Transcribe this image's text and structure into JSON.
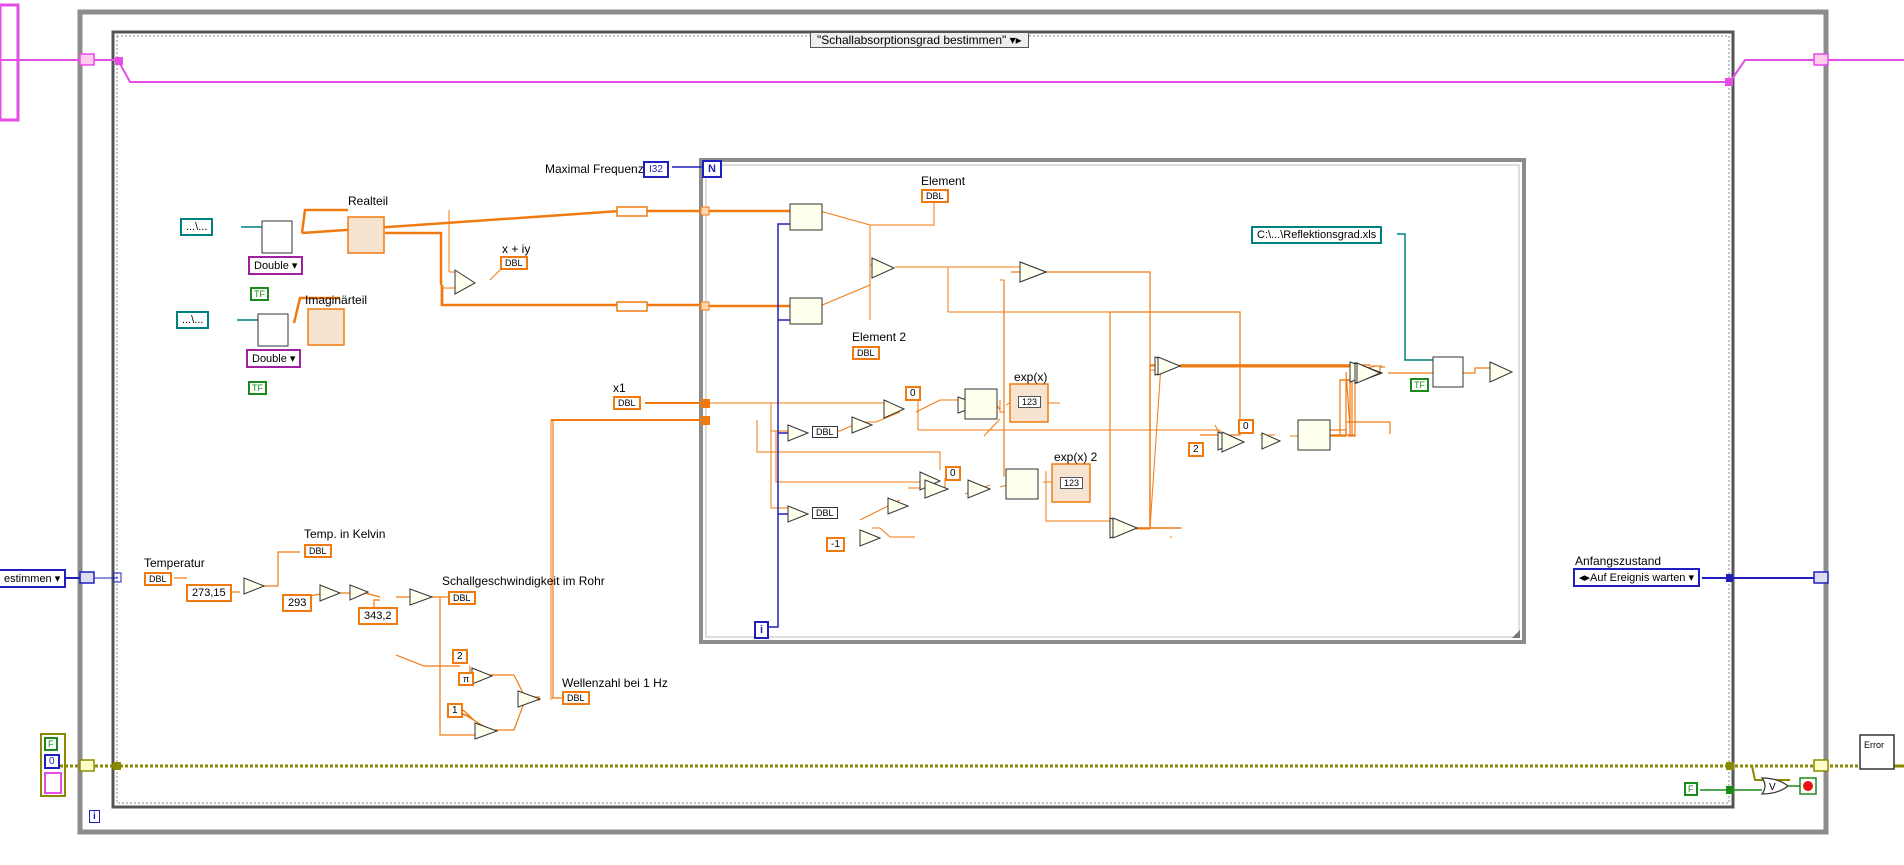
{
  "case_selector": {
    "label": "\"Schallabsorptionsgrad bestimmen\""
  },
  "loop_inputs": {
    "max_freq_label": "Maximal Frequenz",
    "max_freq_type": "I32",
    "n_terminal": "N",
    "i_terminal": "i",
    "outer_i_terminal": "i"
  },
  "file_inputs": [
    {
      "path": "...\\...",
      "type": "Double",
      "bool": "TF"
    },
    {
      "path": "...\\...",
      "type": "Double",
      "bool": "TF"
    }
  ],
  "labels": {
    "realteil": "Realteil",
    "imaginaerteil": "Imaginärteil",
    "x_plus_iy": "x + iy",
    "element": "Element",
    "element2": "Element 2",
    "exp_x": "exp(x)",
    "exp_x2": "exp(x) 2",
    "x1": "x1",
    "temperatur": "Temperatur",
    "temp_kelvin": "Temp. in Kelvin",
    "schallgeschwindigkeit": "Schallgeschwindigkeit im Rohr",
    "wellenzahl": "Wellenzahl bei 1 Hz",
    "anfangszustand": "Anfangszustand"
  },
  "constants": {
    "kelvin_offset": "273,15",
    "t0": "293",
    "c0": "343,2",
    "two_a": "2",
    "one": "1",
    "zero_a": "0",
    "zero_b": "0",
    "zero_c": "0",
    "minus_one": "-1",
    "two_b": "2",
    "pi": "π",
    "dbl": "DBL",
    "display_123": "123"
  },
  "output_path": {
    "path": "C:\\...\\Reflektionsgrad.xls",
    "bool": "TF"
  },
  "state_enum": {
    "left": "estimmen",
    "right": "Auf Ereignis warten"
  },
  "error_cluster": {
    "f_label": "F",
    "value": "0"
  },
  "stop": {
    "f_const": "F"
  },
  "error_out": {
    "label": "Error"
  },
  "colors": {
    "orange_wire": "#f07a10",
    "pink_wire": "#e64ce6",
    "blue_wire": "#1f1fbf",
    "teal_wire": "#008080",
    "error_wire": "#8a8a00",
    "frame_gray": "#8c8c8c"
  }
}
